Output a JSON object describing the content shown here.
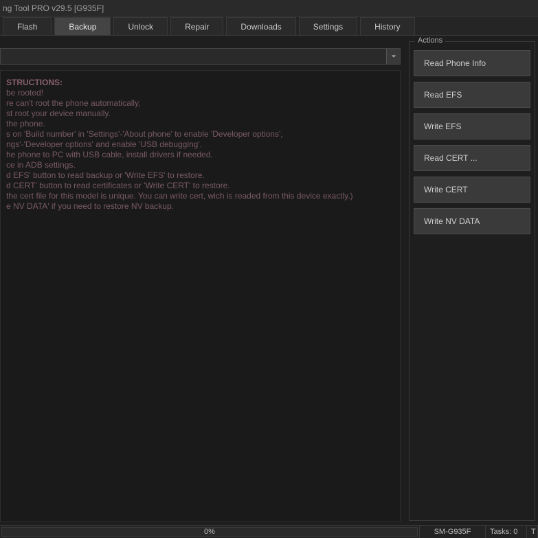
{
  "window": {
    "title": "ng Tool PRO v29.5 [G935F]"
  },
  "tabs": [
    {
      "label": "Flash",
      "active": false
    },
    {
      "label": "Backup",
      "active": true
    },
    {
      "label": "Unlock",
      "active": false
    },
    {
      "label": "Repair",
      "active": false
    },
    {
      "label": "Downloads",
      "active": false
    },
    {
      "label": "Settings",
      "active": false
    },
    {
      "label": "History",
      "active": false
    }
  ],
  "dropdown": {
    "value": ""
  },
  "instructions": {
    "heading": "STRUCTIONS:",
    "lines": [
      "be rooted!",
      "re can't root the phone automatically,",
      "st root your device manually.",
      "the phone.",
      "s on 'Build number' in 'Settings'-'About phone' to enable 'Developer options',",
      "ngs'-'Developer options' and enable 'USB debugging'.",
      "he phone to PC with USB cable, install drivers if needed.",
      "ce in ADB settings.",
      "d EFS' button to read backup or 'Write EFS' to restore.",
      "d CERT' button to read certificates or 'Write CERT' to restore.",
      "the cert file for this model is unique. You can write cert, wich is readed from this device exactly.)",
      "e NV DATA' if you need to restore NV backup."
    ]
  },
  "actions": {
    "group_label": "Actions",
    "buttons": [
      "Read Phone Info",
      "Read EFS",
      "Write EFS",
      "Read CERT ...",
      "Write CERT",
      "Write NV DATA"
    ]
  },
  "status": {
    "progress_text": "0%",
    "model": "SM-G935F",
    "tasks": "Tasks: 0",
    "tail": "T"
  }
}
